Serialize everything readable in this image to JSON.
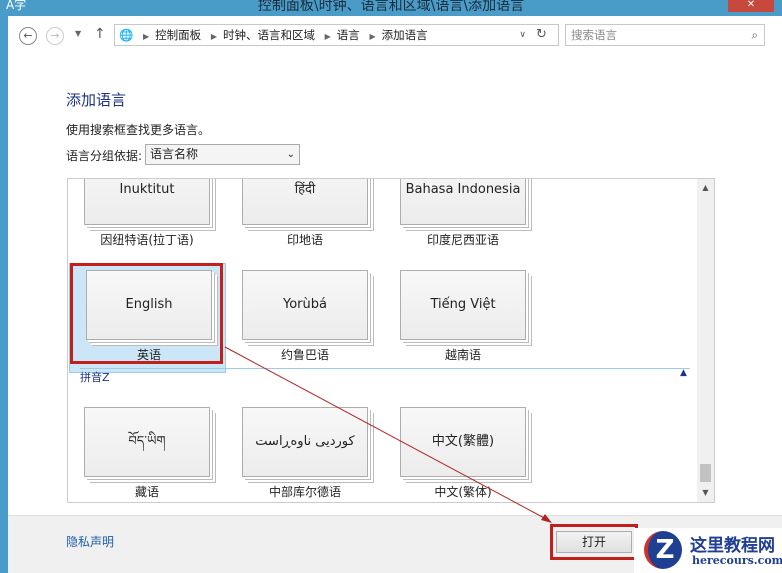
{
  "window": {
    "title": "控制面板\\时钟、语言和区域\\语言\\添加语言",
    "close": "✕"
  },
  "nav": {
    "breadcrumb": [
      "控制面板",
      "时钟、语言和区域",
      "语言",
      "添加语言"
    ],
    "search_placeholder": "搜索语言"
  },
  "page": {
    "heading": "添加语言",
    "description": "使用搜索框查找更多语言。",
    "group_label": "语言分组依据:",
    "group_value": "语言名称"
  },
  "tiles_row1": [
    {
      "native": "Inuktitut",
      "name": "因纽特语(拉丁语)"
    },
    {
      "native": "हिंदी",
      "name": "印地语"
    },
    {
      "native": "Bahasa Indonesia",
      "name": "印度尼西亚语"
    }
  ],
  "tiles_row2": [
    {
      "native": "English",
      "name": "英语"
    },
    {
      "native": "Yorùbá",
      "name": "约鲁巴语"
    },
    {
      "native": "Tiếng Việt",
      "name": "越南语"
    }
  ],
  "group_z": {
    "title": "拼音Z",
    "tiles": [
      {
        "native": "བོད་ཡིག",
        "name": "藏语"
      },
      {
        "native": "کوردیی ناوەڕاست",
        "name": "中部库尔德语"
      },
      {
        "native": "中文(繁體)",
        "name": "中文(繁体)"
      }
    ]
  },
  "footer": {
    "privacy": "隐私声明",
    "open": "打开"
  },
  "watermark": {
    "title": "这里教程网",
    "site": "herecours.com"
  }
}
